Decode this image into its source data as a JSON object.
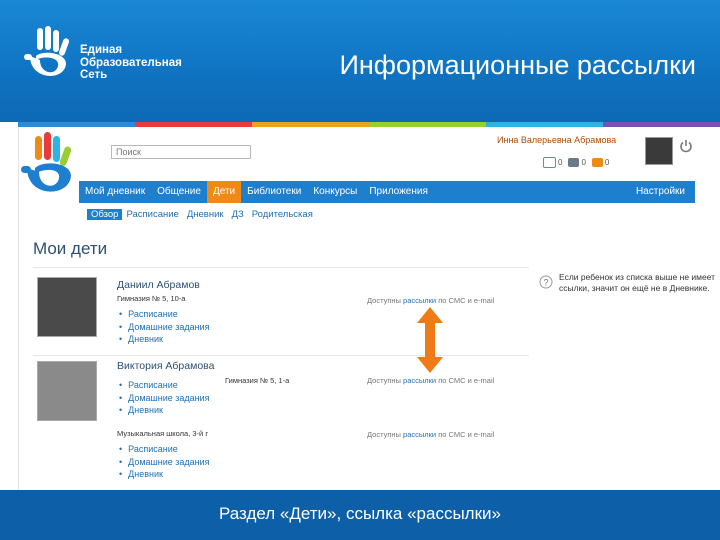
{
  "slide": {
    "title": "Информационные рассылки",
    "brand": [
      "Единая",
      "Образовательная",
      "Сеть"
    ],
    "caption": "Раздел «Дети», ссылка «рассылки»",
    "colors": {
      "header": "#1a88d6",
      "caption_bg": "#0d5fa8",
      "accent": "#f08a16",
      "nav": "#1f7fcf"
    },
    "strip_colors": [
      "#2a8bd8",
      "#e83c3c",
      "#f0a020",
      "#9acd32",
      "#2cb4e6",
      "#7b4fb3"
    ]
  },
  "site": {
    "search_placeholder": "Поиск",
    "user_name": "Инна Валерьевна Абрамова",
    "counters": [
      {
        "icon": "mail-icon",
        "value": "0"
      },
      {
        "icon": "people-icon",
        "value": "0"
      },
      {
        "icon": "orange-box-icon",
        "value": "0"
      }
    ],
    "nav": [
      {
        "label": "Мой дневник"
      },
      {
        "label": "Общение"
      },
      {
        "label": "Дети"
      },
      {
        "label": "Библиотеки"
      },
      {
        "label": "Конкурсы"
      },
      {
        "label": "Приложения"
      }
    ],
    "nav_settings": "Настройки",
    "subnav": [
      "Обзор",
      "Расписание",
      "Дневник",
      "ДЗ",
      "Родительская"
    ],
    "page_title": "Мои дети",
    "children": [
      {
        "name": "Даниил Абрамов",
        "school": "Гимназия № 5, 10-а",
        "links": [
          "Расписание",
          "Домашние задания",
          "Дневник"
        ],
        "mailing_text": "Доступны рассылки по СМС и e-mail",
        "mailing_link": "рассылки"
      },
      {
        "name": "Виктория Абрамова",
        "school": "Гимназия № 5, 1-а",
        "links": [
          "Расписание",
          "Домашние задания",
          "Дневник"
        ],
        "mailing_text": "Доступны рассылки по СМС и e-mail",
        "mailing_link": "рассылки"
      },
      {
        "name": "",
        "school": "Музыкальная школа, 3-й г",
        "links": [
          "Расписание",
          "Домашние задания",
          "Дневник"
        ],
        "mailing_text": "Доступны рассылки по СМС и e-mail",
        "mailing_link": "рассылки"
      }
    ],
    "help_text": "Если ребенок из списка выше не имеет ссылки, значит он ещё не в Дневнике."
  }
}
